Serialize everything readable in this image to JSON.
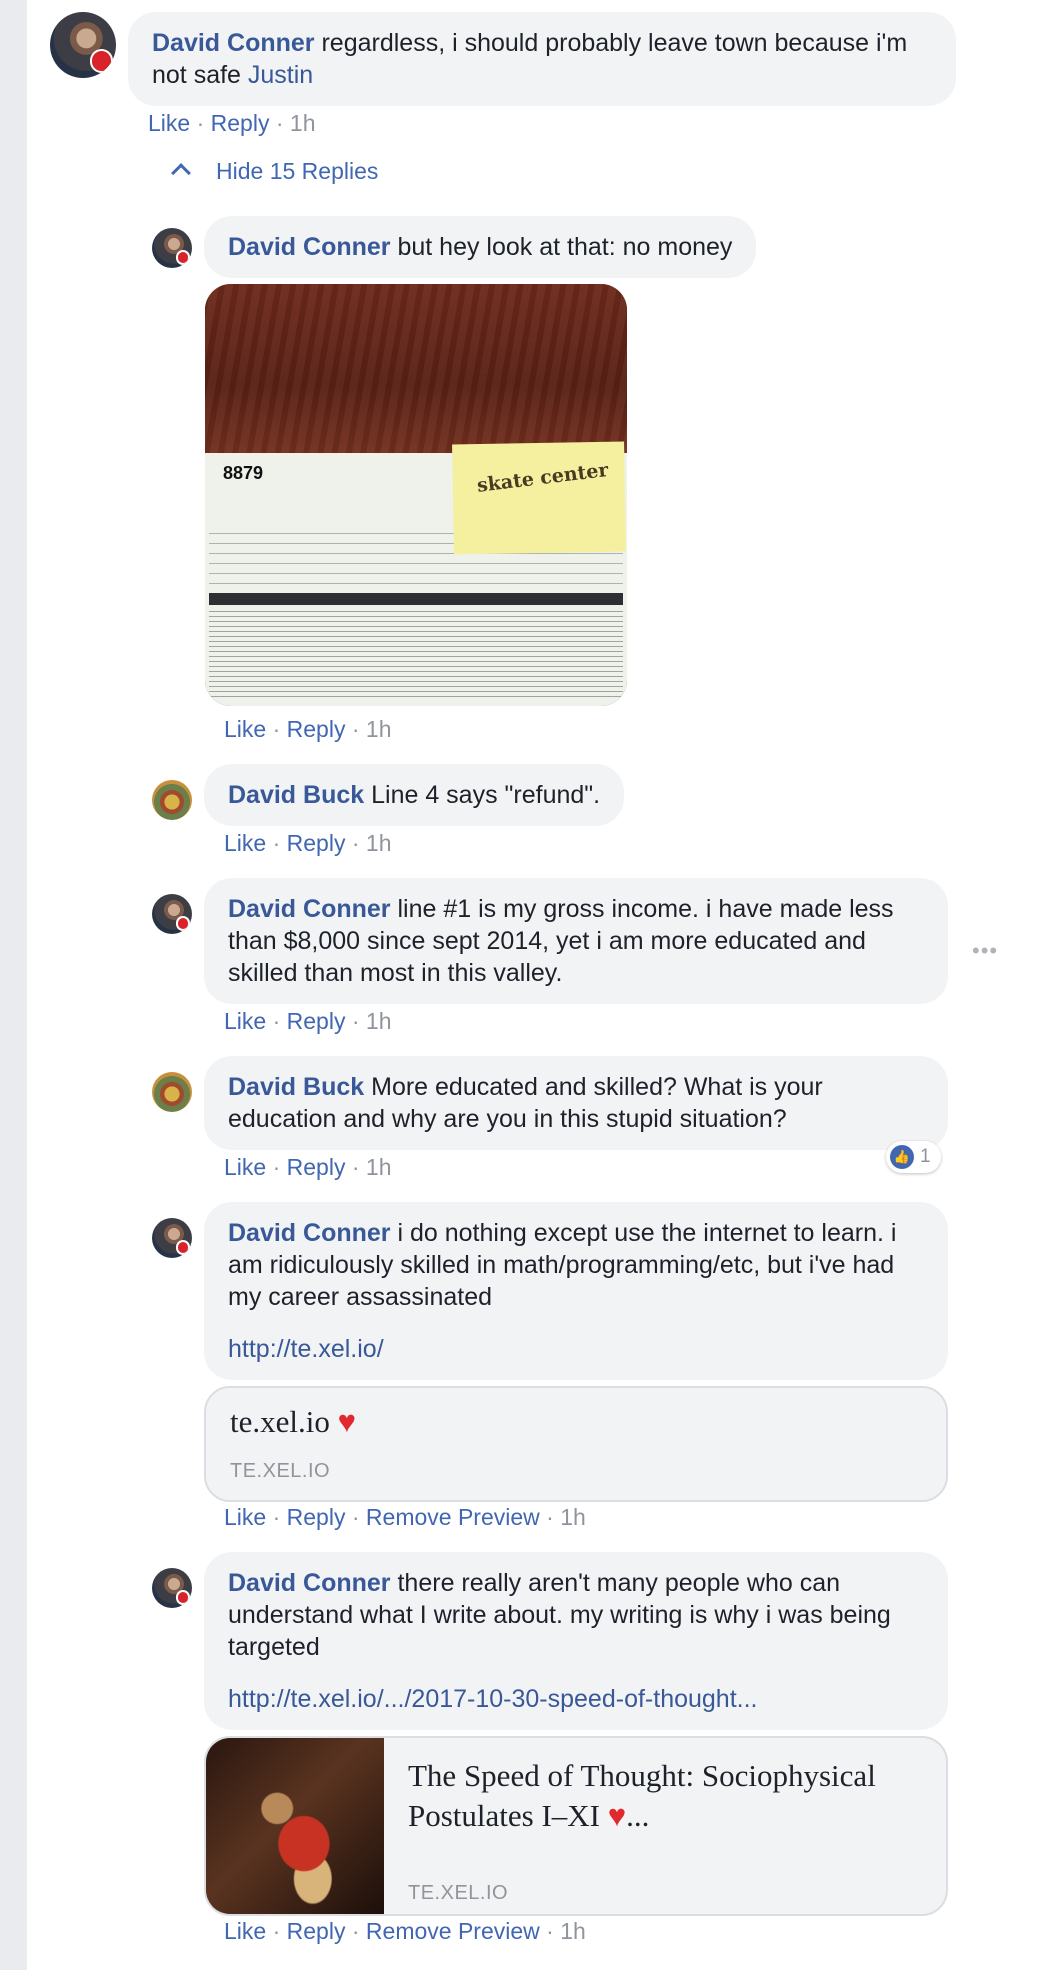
{
  "comments": [
    {
      "author": "David Conner",
      "text": "regardless, i should probably leave town because i'm not safe",
      "mention": "Justin",
      "actions": {
        "like": "Like",
        "reply": "Reply",
        "time": "1h"
      }
    }
  ],
  "hide_replies_label": "Hide 15 Replies",
  "replies": [
    {
      "author": "David Conner",
      "text": "but hey look at that: no money",
      "photo": {
        "form_code": "8879",
        "ticket_text": "skate center"
      },
      "actions": {
        "like": "Like",
        "reply": "Reply",
        "time": "1h"
      }
    },
    {
      "author": "David Buck",
      "text": "Line 4 says \"refund\".",
      "actions": {
        "like": "Like",
        "reply": "Reply",
        "time": "1h"
      }
    },
    {
      "author": "David Conner",
      "text": "line #1 is my gross income. i have made less than $8,000 since sept 2014, yet i am more educated and skilled than most in this valley.",
      "actions": {
        "like": "Like",
        "reply": "Reply",
        "time": "1h"
      }
    },
    {
      "author": "David Buck",
      "text": "More educated and skilled? What is your education and why are you in this stupid situation?",
      "reaction_count": "1",
      "actions": {
        "like": "Like",
        "reply": "Reply",
        "time": "1h"
      }
    },
    {
      "author": "David Conner",
      "text": "i do nothing except use the internet to learn. i am ridiculously skilled in math/programming/etc, but i've had my career assassinated",
      "link": "http://te.xel.io/",
      "preview": {
        "title": "te.xel.io",
        "domain": "TE.XEL.IO"
      },
      "actions": {
        "like": "Like",
        "reply": "Reply",
        "remove_preview": "Remove Preview",
        "time": "1h"
      }
    },
    {
      "author": "David Conner",
      "text": "there really aren't many people who can understand what I write about. my writing is why i was being targeted",
      "link": "http://te.xel.io/.../2017-10-30-speed-of-thought...",
      "preview": {
        "title": "The Speed of Thought: Sociophysical Postulates I–XI",
        "title_suffix": "...",
        "domain": "TE.XEL.IO"
      },
      "actions": {
        "like": "Like",
        "reply": "Reply",
        "remove_preview": "Remove Preview",
        "time": "1h"
      }
    }
  ],
  "symbols": {
    "dot": "·",
    "heart": "♥",
    "more": "•••",
    "thumb": "👍"
  },
  "colors": {
    "link_blue": "#385898",
    "action_blue": "#4267b2",
    "bubble_bg": "#f2f3f5",
    "heart_red": "#e0282e"
  }
}
